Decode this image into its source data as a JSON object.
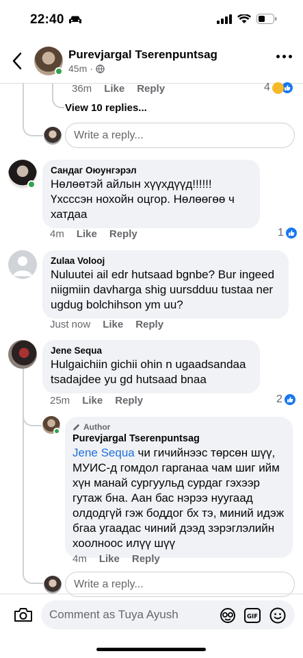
{
  "status_bar": {
    "time": "22:40"
  },
  "header": {
    "name": "Purevjargal Tserenpuntsag",
    "time": "45m"
  },
  "prev_thread": {
    "time": "36m",
    "like": "Like",
    "reply": "Reply",
    "reaction_count": "4",
    "view_replies": "View 10 replies...",
    "reply_placeholder": "Write a reply..."
  },
  "comments": [
    {
      "name": "Сандаг Оюунгэрэл",
      "text": "Нөлөөтэй айлын хүүхдүүд!!!!!! Үхсссэн нохойн оцгор. Нөлөөгөө ч хатдаа",
      "time": "4m",
      "like": "Like",
      "reply": "Reply",
      "reaction_count": "1"
    },
    {
      "name": "Zulaa Volooj",
      "text": "Nuluutei ail edr hutsaad bgnbe? Bur ingeed niigmiin davharga shig uursdduu tustaa ner ugdug bolchihson ym uu?",
      "time": "Just now",
      "like": "Like",
      "reply": "Reply"
    },
    {
      "name": "Jene Sequa",
      "text": "Hulgaichiin gichii ohin n ugaadsandaa tsadajdee yu gd hutsaad bnaa",
      "time": "25m",
      "like": "Like",
      "reply": "Reply",
      "reaction_count": "2"
    }
  ],
  "author_reply": {
    "badge": "Author",
    "name": "Purevjargal Tserenpuntsag",
    "mention": "Jene Sequa",
    "text": " чи гичийнээс төрсөн шүү, МУИС-д гомдол гарганаа чам шиг ийм хүн манай сургуульд сурдаг гэхээр гутаж бна. Аан бас нэрээ нуугаад олдодгүй гэж боддог бх тэ, миний идэж бгаа угаадас чиний дээд зэрэглэлийн хоолноос илүү шүү",
    "time": "4m",
    "like": "Like",
    "reply": "Reply"
  },
  "reply_box2": {
    "placeholder": "Write a reply..."
  },
  "composer": {
    "placeholder": "Comment as Tuya Ayush"
  },
  "colors": {
    "accent": "#1877f2",
    "mention": "#216fdb",
    "bubble": "#f0f2f5",
    "online": "#31a24c"
  }
}
